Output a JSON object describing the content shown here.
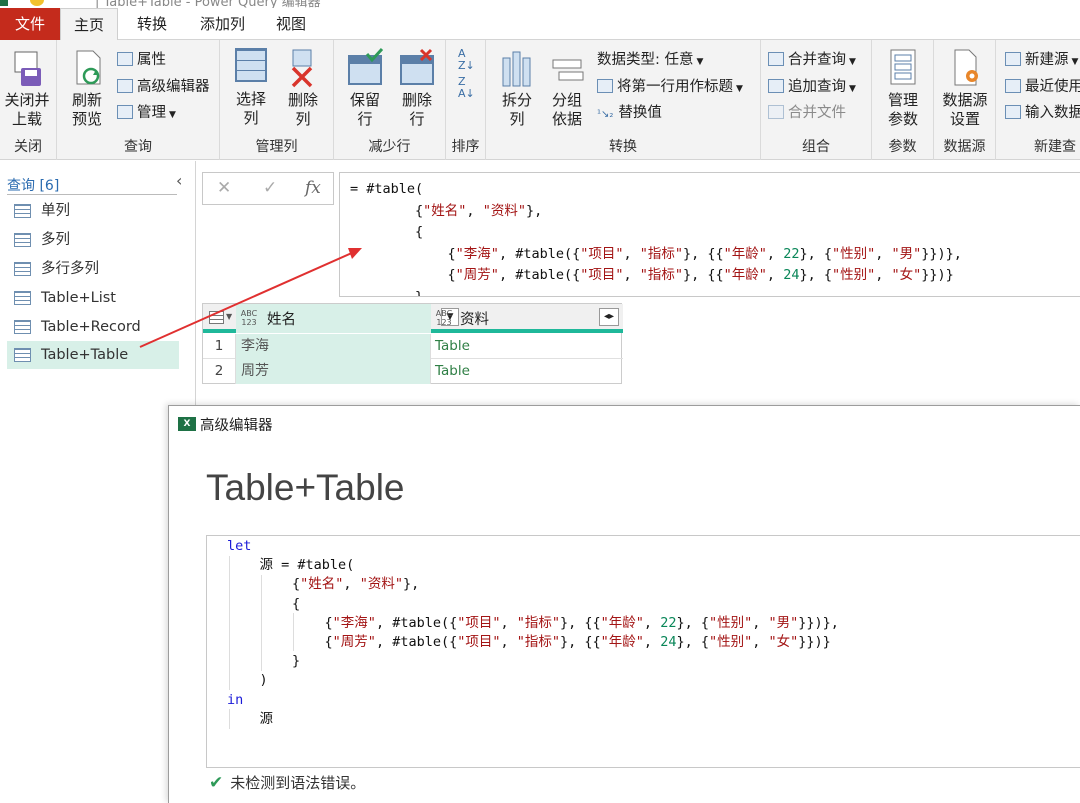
{
  "window": {
    "title": "| Table+Table - Power Query 编辑器"
  },
  "tabs": [
    "文件",
    "主页",
    "转换",
    "添加列",
    "视图"
  ],
  "ribbon": {
    "close_group": {
      "button": "关闭并\n上载",
      "label": "关闭"
    },
    "query_group": {
      "refresh": "刷新\n预览",
      "properties": "属性",
      "advanced_editor": "高级编辑器",
      "manage": "管理",
      "label": "查询"
    },
    "manage_cols_group": {
      "choose": "选择\n列",
      "remove": "删除\n列",
      "label": "管理列"
    },
    "reduce_rows_group": {
      "keep": "保留\n行",
      "remove": "删除\n行",
      "label": "减少行"
    },
    "sort_group": {
      "label": "排序"
    },
    "transform_group": {
      "split": "拆分\n列",
      "group": "分组\n依据",
      "data_type": "数据类型: 任意",
      "first_row_header": "将第一行用作标题",
      "replace": "替换值",
      "label": "转换"
    },
    "combine_group": {
      "merge": "合并查询",
      "append": "追加查询",
      "combine_files": "合并文件",
      "label": "组合"
    },
    "params_group": {
      "manage": "管理\n参数",
      "label": "参数"
    },
    "datasource_group": {
      "settings": "数据源\n设置",
      "label": "数据源"
    },
    "new_query_group": {
      "new_source": "新建源",
      "recent": "最近使用",
      "enter_data": "输入数据",
      "label": "新建查"
    }
  },
  "queries": {
    "header": "查询 [6]",
    "items": [
      "单列",
      "多列",
      "多行多列",
      "Table+List",
      "Table+Record",
      "Table+Table"
    ],
    "selected": "Table+Table"
  },
  "formula_bar": {
    "fx": "fx"
  },
  "preview_table": {
    "columns": [
      {
        "type": "ABC\n123",
        "name": "姓名"
      },
      {
        "type": "ABC\n123",
        "name": "资料"
      }
    ],
    "rows": [
      {
        "n": "1",
        "name": "李海",
        "data": "Table"
      },
      {
        "n": "2",
        "name": "周芳",
        "data": "Table"
      }
    ]
  },
  "advanced_editor": {
    "title": "高级编辑器",
    "heading": "Table+Table",
    "status": "未检测到语法错误。"
  },
  "colors": {
    "file_tab": "#c42b1c",
    "selected_query": "#d8f0e8",
    "column_accent": "#1fb89a",
    "string": "#a31515",
    "number": "#098658",
    "keyword": "#1b1bd8",
    "arrow": "#e03030"
  }
}
